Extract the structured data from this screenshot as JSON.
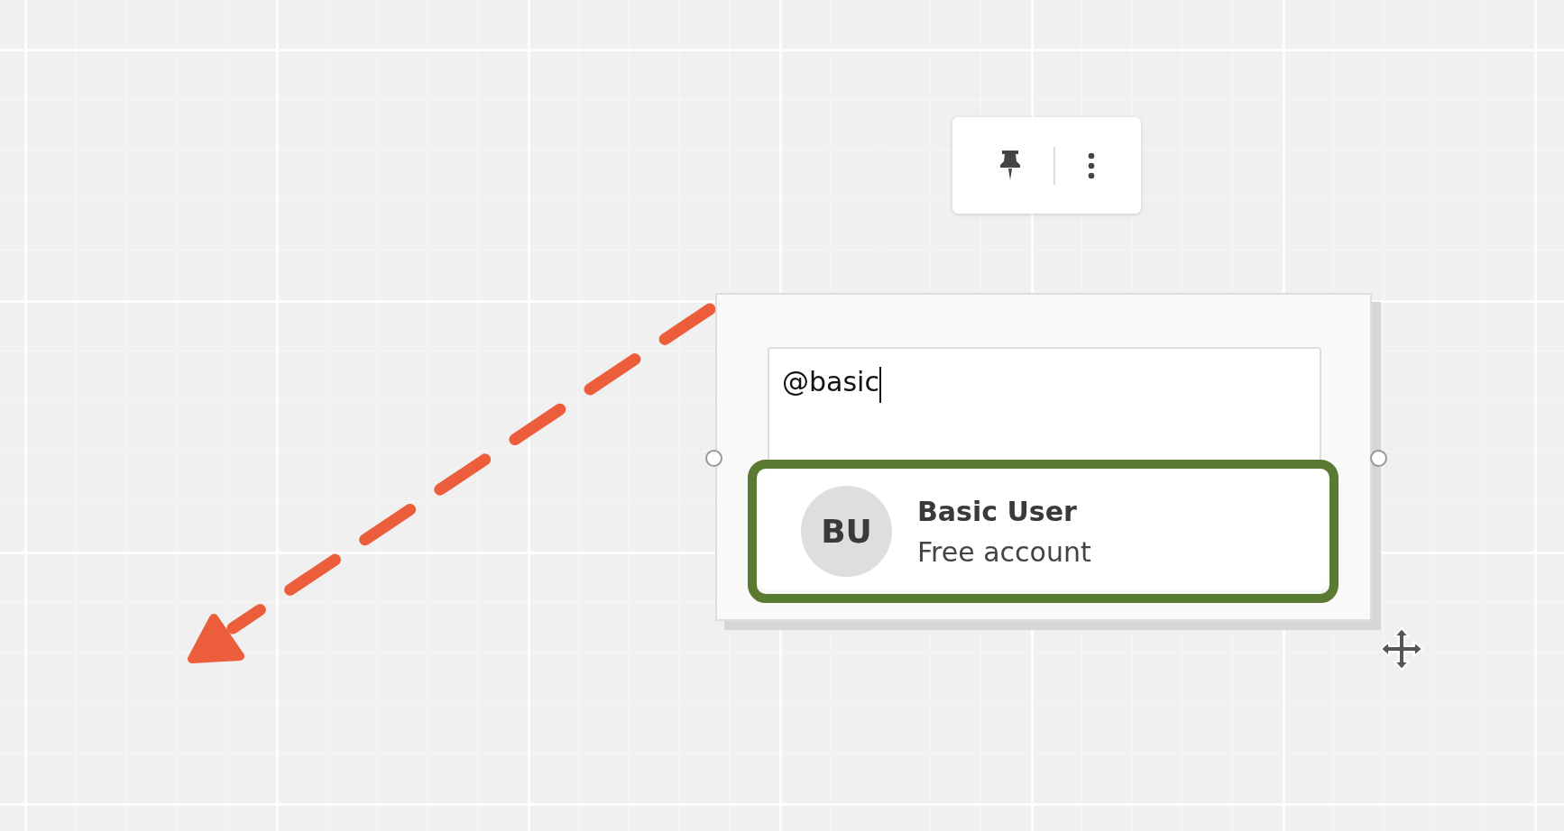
{
  "toolbar": {
    "buttons": [
      {
        "kind": "pin"
      },
      {
        "kind": "more"
      }
    ]
  },
  "note": {
    "value": "@basic"
  },
  "suggestions": [
    {
      "initials": "BU",
      "name": "Basic User",
      "subtitle": "Free account",
      "selected": true
    }
  ]
}
